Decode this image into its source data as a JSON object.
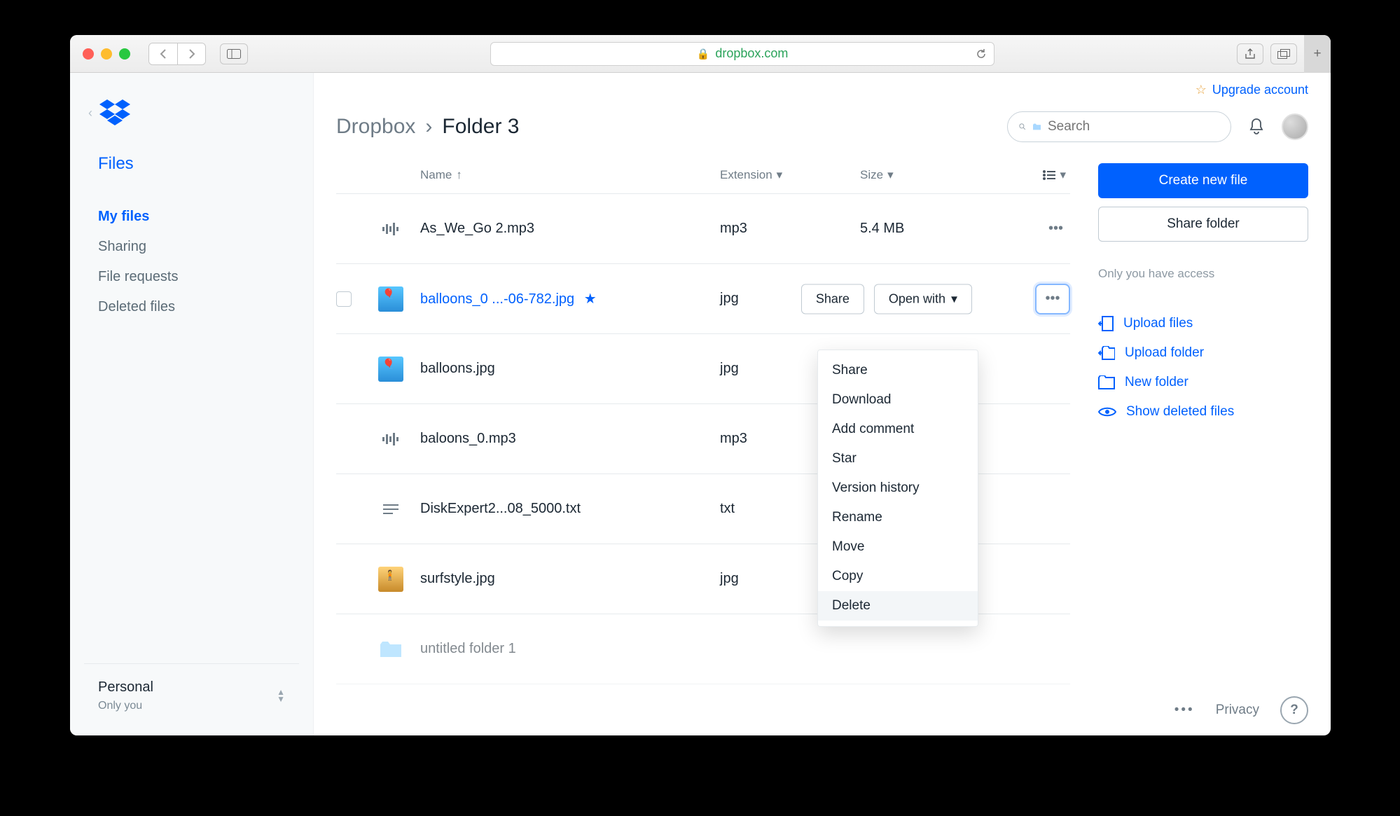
{
  "browser": {
    "domain": "dropbox.com"
  },
  "topbar": {
    "upgrade": "Upgrade account"
  },
  "sidebar": {
    "heading": "Files",
    "items": [
      {
        "label": "My files",
        "active": true
      },
      {
        "label": "Sharing"
      },
      {
        "label": "File requests"
      },
      {
        "label": "Deleted files"
      }
    ],
    "footer": {
      "title": "Personal",
      "subtitle": "Only you"
    }
  },
  "breadcrumb": {
    "root": "Dropbox",
    "current": "Folder 3"
  },
  "search": {
    "placeholder": "Search"
  },
  "columns": {
    "name": "Name",
    "extension": "Extension",
    "size": "Size"
  },
  "files": [
    {
      "name": "As_We_Go 2.mp3",
      "ext": "mp3",
      "size": "5.4 MB",
      "icon": "audio"
    },
    {
      "name": "balloons_0 ...-06-782.jpg",
      "ext": "jpg",
      "size": "",
      "icon": "img",
      "selected": true,
      "starred": true
    },
    {
      "name": "balloons.jpg",
      "ext": "jpg",
      "size": "",
      "icon": "img"
    },
    {
      "name": "baloons_0.mp3",
      "ext": "mp3",
      "size": "",
      "icon": "audio"
    },
    {
      "name": "DiskExpert2...08_5000.txt",
      "ext": "txt",
      "size": "",
      "icon": "text"
    },
    {
      "name": "surfstyle.jpg",
      "ext": "jpg",
      "size": "",
      "icon": "photo"
    },
    {
      "name": "untitled folder 1",
      "ext": "",
      "size": "",
      "icon": "folder"
    }
  ],
  "row_actions": {
    "share": "Share",
    "open_with": "Open with"
  },
  "context_menu": [
    "Share",
    "Download",
    "Add comment",
    "Star",
    "Version history",
    "Rename",
    "Move",
    "Copy",
    "Delete"
  ],
  "side": {
    "create": "Create new file",
    "share_folder": "Share folder",
    "access_note": "Only you have access",
    "links": [
      {
        "label": "Upload files",
        "icon": "upload-file"
      },
      {
        "label": "Upload folder",
        "icon": "upload-folder"
      },
      {
        "label": "New folder",
        "icon": "new-folder"
      },
      {
        "label": "Show deleted files",
        "icon": "eye"
      }
    ]
  },
  "footer": {
    "privacy": "Privacy"
  }
}
